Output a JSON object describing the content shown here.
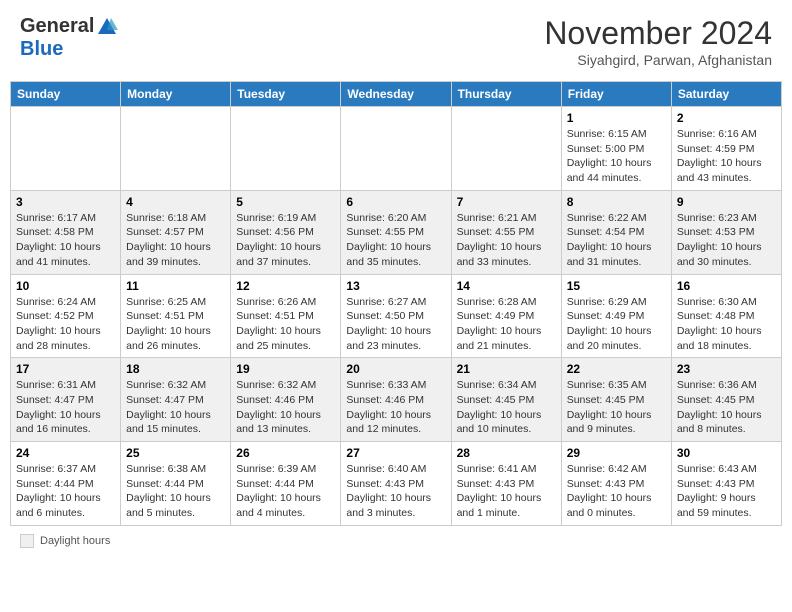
{
  "header": {
    "logo_general": "General",
    "logo_blue": "Blue",
    "month": "November 2024",
    "location": "Siyahgird, Parwan, Afghanistan"
  },
  "weekdays": [
    "Sunday",
    "Monday",
    "Tuesday",
    "Wednesday",
    "Thursday",
    "Friday",
    "Saturday"
  ],
  "footer": {
    "label": "Daylight hours"
  },
  "weeks": [
    [
      {
        "day": "",
        "info": ""
      },
      {
        "day": "",
        "info": ""
      },
      {
        "day": "",
        "info": ""
      },
      {
        "day": "",
        "info": ""
      },
      {
        "day": "",
        "info": ""
      },
      {
        "day": "1",
        "info": "Sunrise: 6:15 AM\nSunset: 5:00 PM\nDaylight: 10 hours and 44 minutes."
      },
      {
        "day": "2",
        "info": "Sunrise: 6:16 AM\nSunset: 4:59 PM\nDaylight: 10 hours and 43 minutes."
      }
    ],
    [
      {
        "day": "3",
        "info": "Sunrise: 6:17 AM\nSunset: 4:58 PM\nDaylight: 10 hours and 41 minutes."
      },
      {
        "day": "4",
        "info": "Sunrise: 6:18 AM\nSunset: 4:57 PM\nDaylight: 10 hours and 39 minutes."
      },
      {
        "day": "5",
        "info": "Sunrise: 6:19 AM\nSunset: 4:56 PM\nDaylight: 10 hours and 37 minutes."
      },
      {
        "day": "6",
        "info": "Sunrise: 6:20 AM\nSunset: 4:55 PM\nDaylight: 10 hours and 35 minutes."
      },
      {
        "day": "7",
        "info": "Sunrise: 6:21 AM\nSunset: 4:55 PM\nDaylight: 10 hours and 33 minutes."
      },
      {
        "day": "8",
        "info": "Sunrise: 6:22 AM\nSunset: 4:54 PM\nDaylight: 10 hours and 31 minutes."
      },
      {
        "day": "9",
        "info": "Sunrise: 6:23 AM\nSunset: 4:53 PM\nDaylight: 10 hours and 30 minutes."
      }
    ],
    [
      {
        "day": "10",
        "info": "Sunrise: 6:24 AM\nSunset: 4:52 PM\nDaylight: 10 hours and 28 minutes."
      },
      {
        "day": "11",
        "info": "Sunrise: 6:25 AM\nSunset: 4:51 PM\nDaylight: 10 hours and 26 minutes."
      },
      {
        "day": "12",
        "info": "Sunrise: 6:26 AM\nSunset: 4:51 PM\nDaylight: 10 hours and 25 minutes."
      },
      {
        "day": "13",
        "info": "Sunrise: 6:27 AM\nSunset: 4:50 PM\nDaylight: 10 hours and 23 minutes."
      },
      {
        "day": "14",
        "info": "Sunrise: 6:28 AM\nSunset: 4:49 PM\nDaylight: 10 hours and 21 minutes."
      },
      {
        "day": "15",
        "info": "Sunrise: 6:29 AM\nSunset: 4:49 PM\nDaylight: 10 hours and 20 minutes."
      },
      {
        "day": "16",
        "info": "Sunrise: 6:30 AM\nSunset: 4:48 PM\nDaylight: 10 hours and 18 minutes."
      }
    ],
    [
      {
        "day": "17",
        "info": "Sunrise: 6:31 AM\nSunset: 4:47 PM\nDaylight: 10 hours and 16 minutes."
      },
      {
        "day": "18",
        "info": "Sunrise: 6:32 AM\nSunset: 4:47 PM\nDaylight: 10 hours and 15 minutes."
      },
      {
        "day": "19",
        "info": "Sunrise: 6:32 AM\nSunset: 4:46 PM\nDaylight: 10 hours and 13 minutes."
      },
      {
        "day": "20",
        "info": "Sunrise: 6:33 AM\nSunset: 4:46 PM\nDaylight: 10 hours and 12 minutes."
      },
      {
        "day": "21",
        "info": "Sunrise: 6:34 AM\nSunset: 4:45 PM\nDaylight: 10 hours and 10 minutes."
      },
      {
        "day": "22",
        "info": "Sunrise: 6:35 AM\nSunset: 4:45 PM\nDaylight: 10 hours and 9 minutes."
      },
      {
        "day": "23",
        "info": "Sunrise: 6:36 AM\nSunset: 4:45 PM\nDaylight: 10 hours and 8 minutes."
      }
    ],
    [
      {
        "day": "24",
        "info": "Sunrise: 6:37 AM\nSunset: 4:44 PM\nDaylight: 10 hours and 6 minutes."
      },
      {
        "day": "25",
        "info": "Sunrise: 6:38 AM\nSunset: 4:44 PM\nDaylight: 10 hours and 5 minutes."
      },
      {
        "day": "26",
        "info": "Sunrise: 6:39 AM\nSunset: 4:44 PM\nDaylight: 10 hours and 4 minutes."
      },
      {
        "day": "27",
        "info": "Sunrise: 6:40 AM\nSunset: 4:43 PM\nDaylight: 10 hours and 3 minutes."
      },
      {
        "day": "28",
        "info": "Sunrise: 6:41 AM\nSunset: 4:43 PM\nDaylight: 10 hours and 1 minute."
      },
      {
        "day": "29",
        "info": "Sunrise: 6:42 AM\nSunset: 4:43 PM\nDaylight: 10 hours and 0 minutes."
      },
      {
        "day": "30",
        "info": "Sunrise: 6:43 AM\nSunset: 4:43 PM\nDaylight: 9 hours and 59 minutes."
      }
    ]
  ]
}
